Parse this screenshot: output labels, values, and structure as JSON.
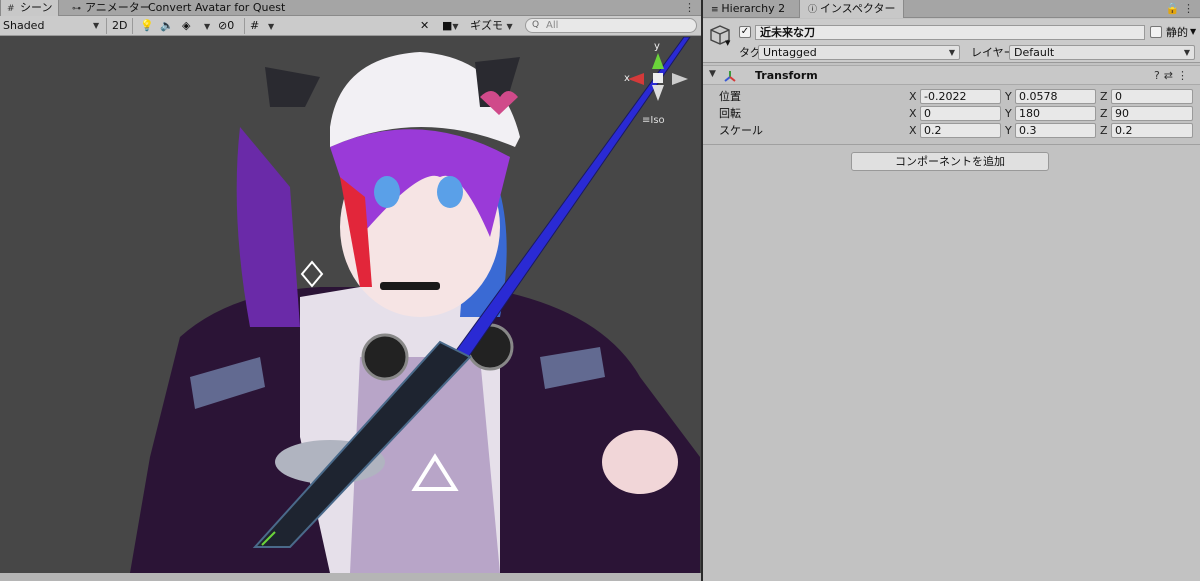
{
  "scene_tabs": {
    "scene": "シーン",
    "animator": "アニメーター",
    "convert": "Convert Avatar for Quest"
  },
  "scene_toolbar": {
    "shading": "Shaded",
    "mode_2d": "2D",
    "hidden_count": "0",
    "gizmos": "ギズモ",
    "search_placeholder": "All"
  },
  "gizmo": {
    "y_label": "y",
    "x_label": "x",
    "projection": "Iso"
  },
  "inspector_tabs": {
    "hierarchy": "Hierarchy 2",
    "inspector": "インスペクター"
  },
  "game_object": {
    "name": "近未来な刀",
    "static_label": "静的",
    "tag_label": "タグ",
    "tag_value": "Untagged",
    "layer_label": "レイヤー",
    "layer_value": "Default"
  },
  "transform": {
    "title": "Transform",
    "rows": [
      {
        "label": "位置",
        "x": "-0.2022",
        "y": "0.0578",
        "z": "0"
      },
      {
        "label": "回転",
        "x": "0",
        "y": "180",
        "z": "90"
      },
      {
        "label": "スケール",
        "x": "0.2",
        "y": "0.3",
        "z": "0.2"
      }
    ],
    "axis_x": "X",
    "axis_y": "Y",
    "axis_z": "Z"
  },
  "add_component": "コンポーネントを追加",
  "colors": {
    "scene_bg": "#474747",
    "sword_blue": "#2a2ad4",
    "hair_purple": "#9a3ad8",
    "hoodie_dark": "#2b1436",
    "gizmo_y": "#6bd43a",
    "gizmo_x": "#d43a3a"
  }
}
